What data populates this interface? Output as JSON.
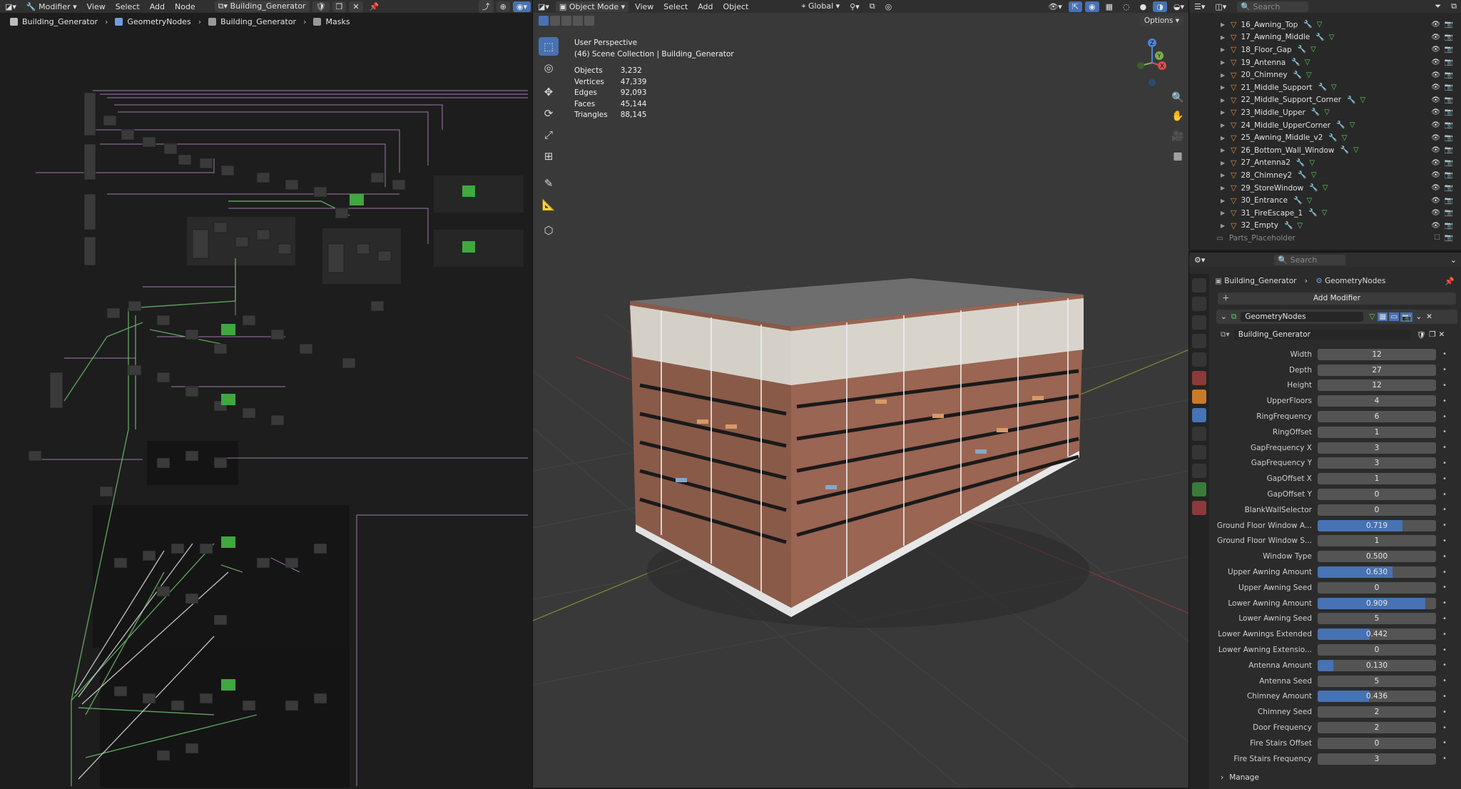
{
  "node_editor": {
    "menu": {
      "editor_label": "Modifier",
      "items": [
        "View",
        "Select",
        "Add",
        "Node"
      ],
      "tree_name": "Building_Generator"
    },
    "breadcrumb": [
      "Building_Generator",
      "GeometryNodes",
      "Building_Generator",
      "Masks"
    ]
  },
  "viewport": {
    "mode": "Object Mode",
    "menu": [
      "View",
      "Select",
      "Add",
      "Object"
    ],
    "orientation": "Global",
    "options_label": "Options",
    "perspective": "User Perspective",
    "collection": "(46) Scene Collection | Building_Generator",
    "stats": [
      {
        "label": "Objects",
        "value": "3,232"
      },
      {
        "label": "Vertices",
        "value": "47,339"
      },
      {
        "label": "Edges",
        "value": "92,093"
      },
      {
        "label": "Faces",
        "value": "45,144"
      },
      {
        "label": "Triangles",
        "value": "88,145"
      }
    ],
    "gizmo": {
      "z": "Z",
      "y": "Y",
      "x": "X"
    }
  },
  "outliner": {
    "search_placeholder": "Search",
    "items": [
      "16_Awning_Top",
      "17_Awning_Middle",
      "18_Floor_Gap",
      "19_Antenna",
      "20_Chimney",
      "21_Middle_Support",
      "22_Middle_Support_Corner",
      "23_Middle_Upper",
      "24_Middle_UpperCorner",
      "25_Awning_Middle_v2",
      "26_Bottom_Wall_Window",
      "27_Antenna2",
      "28_Chimney2",
      "29_StoreWindow",
      "30_Entrance",
      "31_FireEscape_1",
      "32_Empty"
    ],
    "collection": "Parts_Placeholder"
  },
  "properties": {
    "search_placeholder": "Search",
    "breadcrumb": [
      "Building_Generator",
      "GeometryNodes"
    ],
    "add_modifier": "Add Modifier",
    "modifier_name": "GeometryNodes",
    "node_group": "Building_Generator",
    "fields": [
      {
        "label": "Width",
        "value": "12"
      },
      {
        "label": "Depth",
        "value": "27"
      },
      {
        "label": "Height",
        "value": "12"
      },
      {
        "label": "UpperFloors",
        "value": "4"
      },
      {
        "label": "RingFrequency",
        "value": "6"
      },
      {
        "label": "RingOffset",
        "value": "1"
      },
      {
        "label": "GapFrequency X",
        "value": "3"
      },
      {
        "label": "GapFrequency Y",
        "value": "3"
      },
      {
        "label": "GapOffset X",
        "value": "1"
      },
      {
        "label": "GapOffset Y",
        "value": "0"
      },
      {
        "label": "BlankWallSelector",
        "value": "0"
      },
      {
        "label": "Ground Floor Window A...",
        "value": "0.719",
        "fill": 0.719
      },
      {
        "label": "Ground Floor Window S...",
        "value": "1"
      },
      {
        "label": "Window Type",
        "value": "0.500"
      },
      {
        "label": "Upper Awning Amount",
        "value": "0.630",
        "fill": 0.63
      },
      {
        "label": "Upper Awning Seed",
        "value": "0"
      },
      {
        "label": "Lower Awning Amount",
        "value": "0.909",
        "fill": 0.909
      },
      {
        "label": "Lower Awning Seed",
        "value": "5"
      },
      {
        "label": "Lower Awnings Extended",
        "value": "0.442",
        "fill": 0.442
      },
      {
        "label": "Lower Awning Extensio...",
        "value": "0"
      },
      {
        "label": "Antenna Amount",
        "value": "0.130",
        "fill": 0.13
      },
      {
        "label": "Antenna Seed",
        "value": "5"
      },
      {
        "label": "Chimney Amount",
        "value": "0.436",
        "fill": 0.436
      },
      {
        "label": "Chimney Seed",
        "value": "2"
      },
      {
        "label": "Door Frequency",
        "value": "2"
      },
      {
        "label": "Fire Stairs Offset",
        "value": "0"
      },
      {
        "label": "Fire Stairs Frequency",
        "value": "3"
      }
    ],
    "manage_label": "Manage"
  }
}
